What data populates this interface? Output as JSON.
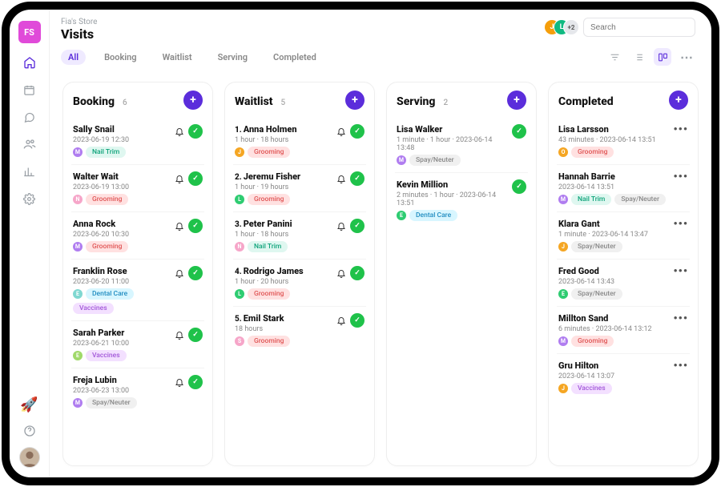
{
  "header": {
    "store_badge": "FS",
    "store_sub": "Fia's Store",
    "page_title": "Visits",
    "search_placeholder": "Search",
    "avatar_more": "+2"
  },
  "tabs": [
    {
      "label": "All",
      "active": true
    },
    {
      "label": "Booking",
      "active": false
    },
    {
      "label": "Waitlist",
      "active": false
    },
    {
      "label": "Serving",
      "active": false
    },
    {
      "label": "Completed",
      "active": false
    }
  ],
  "columns": {
    "booking": {
      "title": "Booking",
      "count": "6",
      "cards": [
        {
          "name": "Sally Snail",
          "meta": "2023-06-19 12:30",
          "dot": "M",
          "dotColor": "#b07df0",
          "tags": [
            [
              "Nail Trim",
              "#dff7f0",
              "#0ea37a"
            ]
          ],
          "actions": "bell-check"
        },
        {
          "name": "Walter Wait",
          "meta": "2023-06-19 13:00",
          "dot": "N",
          "dotColor": "#f6a6c9",
          "tags": [
            [
              "Grooming",
              "#ffe1e1",
              "#e05555"
            ]
          ],
          "actions": "bell-check"
        },
        {
          "name": "Anna Rock",
          "meta": "2023-06-20 10:30",
          "dot": "M",
          "dotColor": "#b07df0",
          "tags": [
            [
              "Grooming",
              "#ffe1e1",
              "#e05555"
            ]
          ],
          "actions": "bell-check"
        },
        {
          "name": "Franklin Rose",
          "meta": "2023-06-20 11:00",
          "dot": "E",
          "dotColor": "#7fd8d1",
          "tags": [
            [
              "Dental Care",
              "#d8f6ff",
              "#1f8cc0"
            ],
            [
              "Vaccines",
              "#f3e0ff",
              "#a256d9"
            ]
          ],
          "actions": "bell-check"
        },
        {
          "name": "Sarah Parker",
          "meta": "2023-06-21 10:00",
          "dot": "E",
          "dotColor": "#a0d96a",
          "tags": [
            [
              "Vaccines",
              "#f3e0ff",
              "#a256d9"
            ]
          ],
          "actions": "bell-check"
        },
        {
          "name": "Freja Lubin",
          "meta": "2023-06-23 13:00",
          "dot": "M",
          "dotColor": "#b07df0",
          "tags": [
            [
              "Spay/Neuter",
              "#f0f0f0",
              "#888"
            ]
          ],
          "actions": "bell-check"
        }
      ]
    },
    "waitlist": {
      "title": "Waitlist",
      "count": "5",
      "cards": [
        {
          "num": "1.",
          "name": "Anna Holmen",
          "meta": "1 hour · 18 hours",
          "dot": "J",
          "dotColor": "#f5a623",
          "tags": [
            [
              "Grooming",
              "#ffe1e1",
              "#e05555"
            ]
          ],
          "actions": "bell-check"
        },
        {
          "num": "2.",
          "name": "Jeremu Fisher",
          "meta": "1 hour · 19 hours",
          "dot": "L",
          "dotColor": "#2ecc71",
          "tags": [
            [
              "Grooming",
              "#ffe1e1",
              "#e05555"
            ]
          ],
          "actions": "bell-check"
        },
        {
          "num": "3.",
          "name": "Peter Panini",
          "meta": "1 hour · 18 hours",
          "dot": "N",
          "dotColor": "#f6a6c9",
          "tags": [
            [
              "Nail Trim",
              "#dff7f0",
              "#0ea37a"
            ]
          ],
          "actions": "bell-check"
        },
        {
          "num": "4.",
          "name": "Rodrigo James",
          "meta": "1 hour · 20 hours",
          "dot": "L",
          "dotColor": "#2ecc71",
          "tags": [
            [
              "Grooming",
              "#ffe1e1",
              "#e05555"
            ]
          ],
          "actions": "bell-check"
        },
        {
          "num": "5.",
          "name": "Emil Stark",
          "meta": "18 hours",
          "dot": "S",
          "dotColor": "#f6a6c9",
          "tags": [
            [
              "Grooming",
              "#ffe1e1",
              "#e05555"
            ]
          ],
          "actions": "bell-check"
        }
      ]
    },
    "serving": {
      "title": "Serving",
      "count": "2",
      "cards": [
        {
          "name": "Lisa Walker",
          "meta": "1 minute · 1 hour · 2023-06-14 13:48",
          "dot": "M",
          "dotColor": "#b07df0",
          "tags": [
            [
              "Spay/Neuter",
              "#f0f0f0",
              "#888"
            ]
          ],
          "actions": "check"
        },
        {
          "name": "Kevin Million",
          "meta": "2 minutes · 1 hour · 2023-06-14 13:51",
          "dot": "E",
          "dotColor": "#2ecc71",
          "tags": [
            [
              "Dental Care",
              "#d8f6ff",
              "#1f8cc0"
            ]
          ],
          "actions": "check"
        }
      ]
    },
    "completed": {
      "title": "Completed",
      "count": "",
      "cards": [
        {
          "name": "Lisa Larsson",
          "meta": "43 minutes · 2023-06-14 13:51",
          "dot": "O",
          "dotColor": "#f5a623",
          "tags": [
            [
              "Grooming",
              "#ffe1e1",
              "#e05555"
            ]
          ],
          "actions": "more"
        },
        {
          "name": "Hannah Barrie",
          "meta": "2023-06-14 13:51",
          "dot": "M",
          "dotColor": "#b07df0",
          "tags": [
            [
              "Nail Trim",
              "#dff7f0",
              "#0ea37a"
            ],
            [
              "Spay/Neuter",
              "#f0f0f0",
              "#888"
            ]
          ],
          "actions": "more"
        },
        {
          "name": "Klara Gant",
          "meta": "1 minute · 2023-06-14 13:47",
          "dot": "J",
          "dotColor": "#f5a623",
          "tags": [
            [
              "Spay/Neuter",
              "#f0f0f0",
              "#888"
            ]
          ],
          "actions": "more"
        },
        {
          "name": "Fred Good",
          "meta": "2023-06-14 13:43",
          "dot": "E",
          "dotColor": "#2ecc71",
          "tags": [
            [
              "Spay/Neuter",
              "#f0f0f0",
              "#888"
            ]
          ],
          "actions": "more"
        },
        {
          "name": "Millton Sand",
          "meta": "6 minutes · 2023-06-14 13:12",
          "dot": "M",
          "dotColor": "#b07df0",
          "tags": [
            [
              "Grooming",
              "#ffe1e1",
              "#e05555"
            ]
          ],
          "actions": "more"
        },
        {
          "name": "Gru Hilton",
          "meta": "2023-06-14 13:07",
          "dot": "J",
          "dotColor": "#f5a623",
          "tags": [
            [
              "Vaccines",
              "#f3e0ff",
              "#a256d9"
            ]
          ],
          "actions": "more"
        }
      ]
    }
  },
  "sidebarIcons": [
    "home",
    "calendar",
    "chat",
    "users",
    "chart",
    "settings"
  ]
}
